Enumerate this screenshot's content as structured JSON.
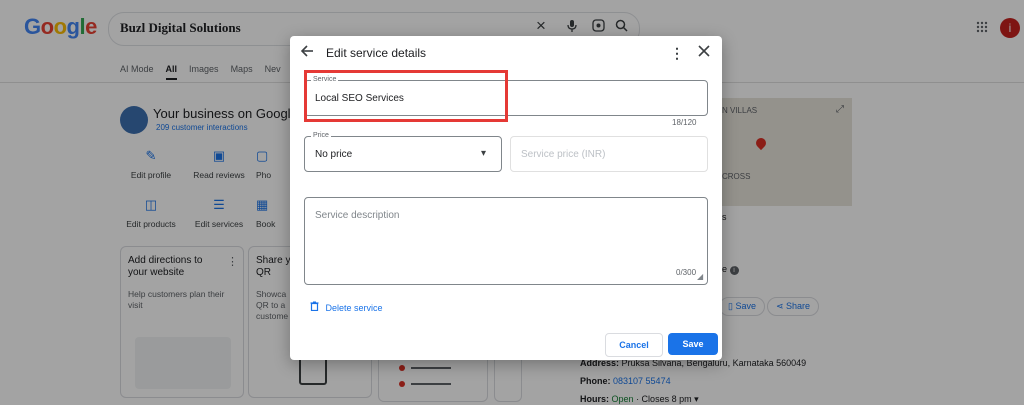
{
  "header": {
    "logo_letters": [
      {
        "ch": "G",
        "color": "#4285F4"
      },
      {
        "ch": "o",
        "color": "#EA4335"
      },
      {
        "ch": "o",
        "color": "#FBBC05"
      },
      {
        "ch": "g",
        "color": "#4285F4"
      },
      {
        "ch": "l",
        "color": "#34A853"
      },
      {
        "ch": "e",
        "color": "#EA4335"
      }
    ],
    "search_query": "Buzl Digital Solutions",
    "clear_icon": "×",
    "mic_icon": "🎤",
    "lens_icon": "◉",
    "search_icon": "⌕",
    "apps_icon": "⋮⋮⋮",
    "avatar_letter": "i"
  },
  "tabs": {
    "items": [
      "AI Mode",
      "All",
      "Images",
      "Maps",
      "Nev"
    ],
    "active": "All"
  },
  "business": {
    "title": "Your business on Google",
    "interactions": "209 customer interactions",
    "actions_row1": [
      "Edit profile",
      "Read reviews",
      "Pho"
    ],
    "actions_row2": [
      "Edit products",
      "Edit services",
      "Book"
    ],
    "card1_title": "Add directions to your website",
    "card1_body": "Help customers plan their visit",
    "card2_title": "Share y QR",
    "card2_body": "Showca QR to a custome"
  },
  "map": {
    "label_villas": "N VILLAS",
    "label_cross": "CROSS"
  },
  "info": {
    "save_label": "Save",
    "share_label": "Share",
    "address_label": "Address:",
    "address_value": "Pruksa Silvana, Bengaluru, Karnataka 560049",
    "phone_label": "Phone:",
    "phone_value": "083107 55474",
    "hours_label": "Hours:",
    "hours_open": "Open",
    "hours_close": "· Closes 8 pm ▾",
    "partial_e": "e"
  },
  "dialog": {
    "title": "Edit service details",
    "service_label": "Service",
    "service_value": "Local SEO Services",
    "service_counter": "18/120",
    "price_label": "Price",
    "price_value": "No price",
    "price_dropdown_icon": "▾",
    "price_amount_placeholder": "Service price (INR)",
    "description_placeholder": "Service description",
    "description_counter": "0/300",
    "delete_label": "Delete service",
    "cancel_label": "Cancel",
    "save_label": "Save"
  },
  "colors": {
    "accent": "#1a73e8",
    "highlight": "#e53935"
  }
}
